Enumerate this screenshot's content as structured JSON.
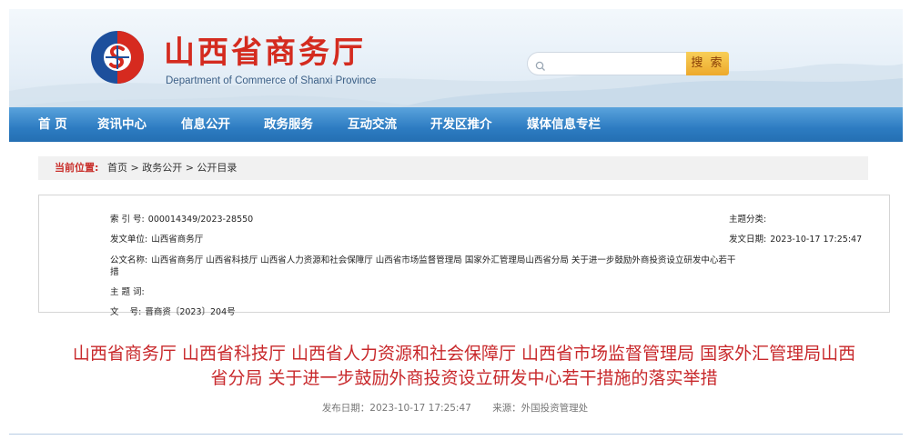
{
  "header": {
    "title": "山西省商务厅",
    "subtitle": "Department of Commerce of Shanxi Province",
    "search": {
      "placeholder": "",
      "button_label": "搜 索"
    }
  },
  "nav": {
    "items": [
      "首 页",
      "资讯中心",
      "信息公开",
      "政务服务",
      "互动交流",
      "开发区推介",
      "媒体信息专栏"
    ]
  },
  "breadcrumb": {
    "label": "当前位置:",
    "path": "首页 > 政务公开 > 公开目录"
  },
  "info": {
    "index_key": "索 引 号:",
    "index_value": "000014349/2023-28550",
    "category_key": "主题分类:",
    "category_value": "",
    "issuer_key": "发文单位:",
    "issuer_value": "山西省商务厅",
    "date_key": "发文日期:",
    "date_value": "2023-10-17 17:25:47",
    "name_key": "公文名称:",
    "name_value_line1": "山西省商务厅 山西省科技厅 山西省人力资源和社会保障厅 山西省市场监督管理局 国家外汇管理局山西省分局 关于进一步鼓励外商投资设立研发中心若干",
    "name_value_line2": "措",
    "keywords_key": "主 题 词:",
    "keywords_value": "",
    "docnum_key": "文    号:",
    "docnum_value": "晋商资〔2023〕204号"
  },
  "document": {
    "title_line1": "山西省商务厅 山西省科技厅 山西省人力资源和社会保障厅 山西省市场监督管理局 国家外汇管理局山西",
    "title_line2": "省分局 关于进一步鼓励外商投资设立研发中心若干措施的落实举措",
    "publish_date": "发布日期：2023-10-17 17:25:47",
    "source": "来源：外国投资管理处"
  },
  "colors": {
    "brand_red": "#d42b1f",
    "nav_blue": "#2d7cc2",
    "title_red": "#c8282b",
    "search_button": "#eda92c"
  },
  "icons": {
    "logo": "commerce-emblem",
    "search": "search-icon"
  }
}
